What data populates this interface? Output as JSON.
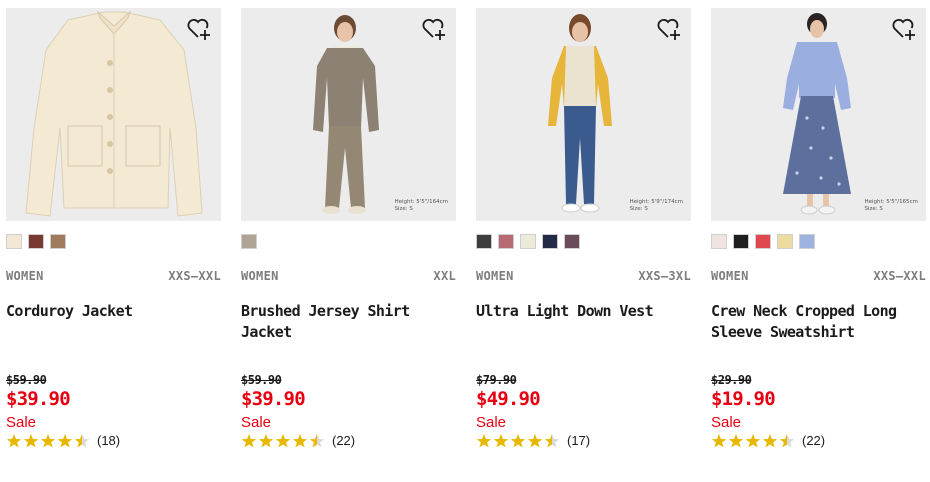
{
  "colors": {
    "sale": "#e60012",
    "star": "#e8b800",
    "star_empty": "#d9d9d9"
  },
  "products": [
    {
      "category": "WOMEN",
      "sizes": "XXS–XXL",
      "name": "Corduroy Jacket",
      "original_price": "$59.90",
      "price": "$39.90",
      "flag": "Sale",
      "rating": 4.5,
      "reviews": "(18)",
      "swatches": [
        "#f3e8d6",
        "#7a3a33",
        "#a07a5c"
      ],
      "measure": ""
    },
    {
      "category": "WOMEN",
      "sizes": "XXL",
      "name": "Brushed Jersey Shirt Jacket",
      "original_price": "$59.90",
      "price": "$39.90",
      "flag": "Sale",
      "rating": 4.5,
      "reviews": "(22)",
      "swatches": [
        "#b0a495"
      ],
      "measure": "Height: 5'5\"/164cm\nSize: S"
    },
    {
      "category": "WOMEN",
      "sizes": "XXS–3XL",
      "name": "Ultra Light Down Vest",
      "original_price": "$79.90",
      "price": "$49.90",
      "flag": "Sale",
      "rating": 4.5,
      "reviews": "(17)",
      "swatches": [
        "#3d3d3f",
        "#b86a72",
        "#ecebd9",
        "#232a45",
        "#6b4c5a"
      ],
      "measure": "Height: 5'9\"/174cm\nSize: S"
    },
    {
      "category": "WOMEN",
      "sizes": "XXS–XXL",
      "name": "Crew Neck Cropped Long Sleeve Sweatshirt",
      "original_price": "$29.90",
      "price": "$19.90",
      "flag": "Sale",
      "rating": 4.5,
      "reviews": "(22)",
      "swatches": [
        "#efe4df",
        "#1e1e1e",
        "#e0474f",
        "#ecdca0",
        "#9eb3e0"
      ],
      "measure": "Height: 5'5\"/165cm\nSize: S"
    }
  ]
}
